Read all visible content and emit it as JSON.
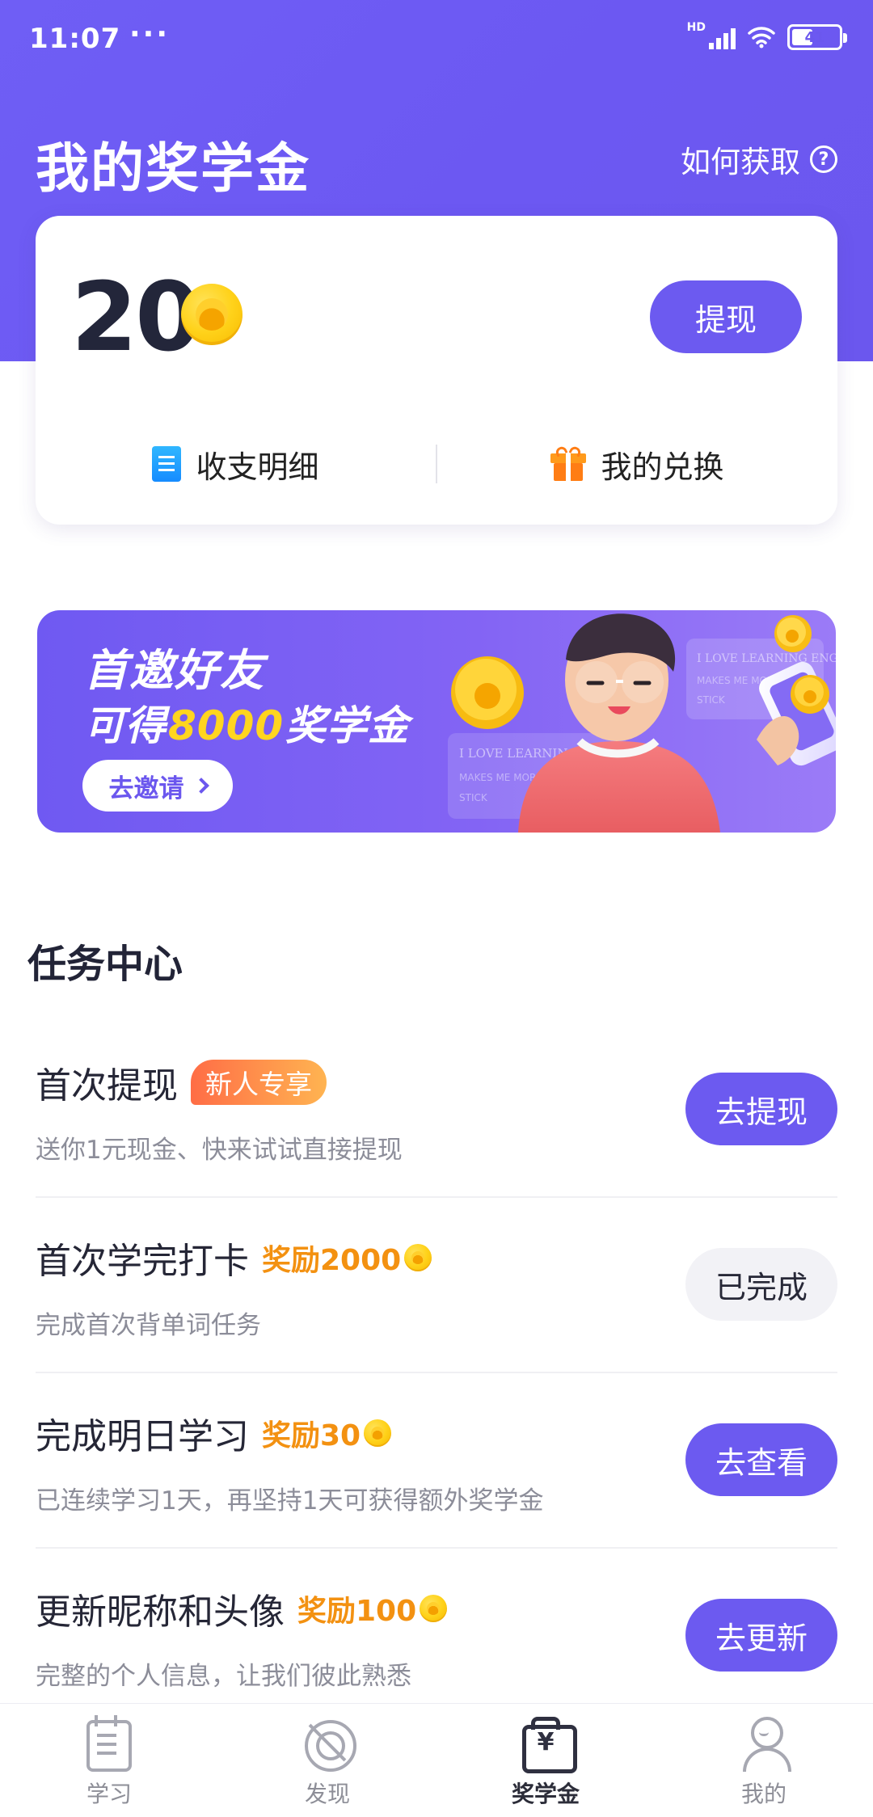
{
  "status_bar": {
    "time": "11:07",
    "dots": "···",
    "network": "HD",
    "battery": "41"
  },
  "header": {
    "title": "我的奖学金",
    "help_link": "如何获取",
    "help_icon": "question-circle-icon"
  },
  "balance_card": {
    "value": "20",
    "currency_icon": "gold-coin-icon",
    "withdraw_label": "提现",
    "links": [
      {
        "label": "收支明细",
        "icon": "receipt-icon"
      },
      {
        "label": "我的兑换",
        "icon": "gift-icon"
      }
    ]
  },
  "invite_banner": {
    "title": "首邀好友",
    "subtitle_prefix": "可得",
    "subtitle_highlight": "8000",
    "subtitle_suffix": "奖学金",
    "button_label": "去邀请",
    "art_text_1": "I LOVE LEARNING ENGLISH",
    "art_text_2": "MAKES ME MORE",
    "art_text_3": "STICK",
    "art_text_4": "I LOVE LEARNING ENG",
    "art_text_5": "MAKES ME MORE",
    "art_text_6": "STICK"
  },
  "tasks": {
    "title": "任务中心",
    "items": [
      {
        "name": "首次提现",
        "tag": "新人专享",
        "reward": "",
        "description": "送你1元现金、快来试试直接提现",
        "button": "去提现",
        "done": false
      },
      {
        "name": "首次学完打卡",
        "tag": "",
        "reward": "奖励2000",
        "description": "完成首次背单词任务",
        "button": "已完成",
        "done": true
      },
      {
        "name": "完成明日学习",
        "tag": "",
        "reward": "奖励30",
        "description": "已连续学习1天，再坚持1天可获得额外奖学金",
        "button": "去查看",
        "done": false
      },
      {
        "name": "更新昵称和头像",
        "tag": "",
        "reward": "奖励100",
        "description": "完整的个人信息，让我们彼此熟悉",
        "button": "去更新",
        "done": false
      }
    ]
  },
  "bottom_nav": {
    "items": [
      {
        "label": "学习",
        "icon": "calendar-book-icon",
        "active": false
      },
      {
        "label": "发现",
        "icon": "compass-icon",
        "active": false
      },
      {
        "label": "奖学金",
        "icon": "wallet-yuan-icon",
        "active": true
      },
      {
        "label": "我的",
        "icon": "profile-icon",
        "active": false
      }
    ]
  },
  "colors": {
    "brand": "#6C5AF0",
    "reward": "#F39111",
    "tag_start": "#FF6D46",
    "tag_end": "#FFB451"
  }
}
